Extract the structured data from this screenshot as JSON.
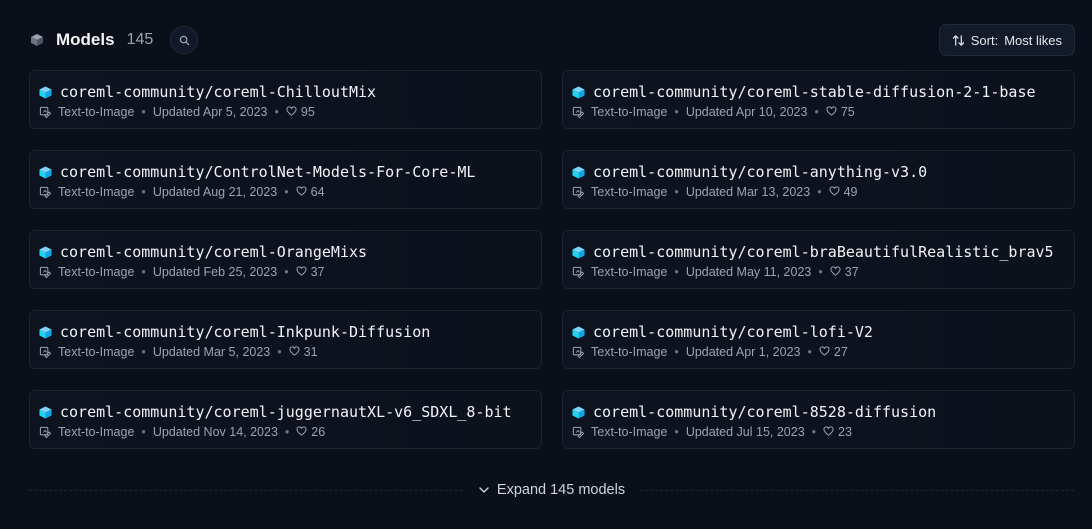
{
  "header": {
    "icon": "cube-icon",
    "title": "Models",
    "count": "145",
    "search_icon": "search-icon",
    "sort_label": "Sort:",
    "sort_value": "Most likes"
  },
  "models": [
    {
      "name": "coreml-community/coreml-ChilloutMix",
      "task": "Text-to-Image",
      "updated": "Updated Apr 5, 2023",
      "likes": "95"
    },
    {
      "name": "coreml-community/coreml-stable-diffusion-2-1-base",
      "task": "Text-to-Image",
      "updated": "Updated Apr 10, 2023",
      "likes": "75"
    },
    {
      "name": "coreml-community/ControlNet-Models-For-Core-ML",
      "task": "Text-to-Image",
      "updated": "Updated Aug 21, 2023",
      "likes": "64"
    },
    {
      "name": "coreml-community/coreml-anything-v3.0",
      "task": "Text-to-Image",
      "updated": "Updated Mar 13, 2023",
      "likes": "49"
    },
    {
      "name": "coreml-community/coreml-OrangeMixs",
      "task": "Text-to-Image",
      "updated": "Updated Feb 25, 2023",
      "likes": "37"
    },
    {
      "name": "coreml-community/coreml-braBeautifulRealistic_brav5",
      "task": "Text-to-Image",
      "updated": "Updated May 11, 2023",
      "likes": "37"
    },
    {
      "name": "coreml-community/coreml-Inkpunk-Diffusion",
      "task": "Text-to-Image",
      "updated": "Updated Mar 5, 2023",
      "likes": "31"
    },
    {
      "name": "coreml-community/coreml-lofi-V2",
      "task": "Text-to-Image",
      "updated": "Updated Apr 1, 2023",
      "likes": "27"
    },
    {
      "name": "coreml-community/coreml-juggernautXL-v6_SDXL_8-bit",
      "task": "Text-to-Image",
      "updated": "Updated Nov 14, 2023",
      "likes": "26"
    },
    {
      "name": "coreml-community/coreml-8528-diffusion",
      "task": "Text-to-Image",
      "updated": "Updated Jul 15, 2023",
      "likes": "23"
    }
  ],
  "expand": {
    "label": "Expand 145 models",
    "icon": "chevron-down-icon"
  },
  "colors": {
    "background": "#0b0f19",
    "card_border": "#1c2333",
    "model_cube": "#38bdf8",
    "muted_text": "#9ca3af"
  }
}
